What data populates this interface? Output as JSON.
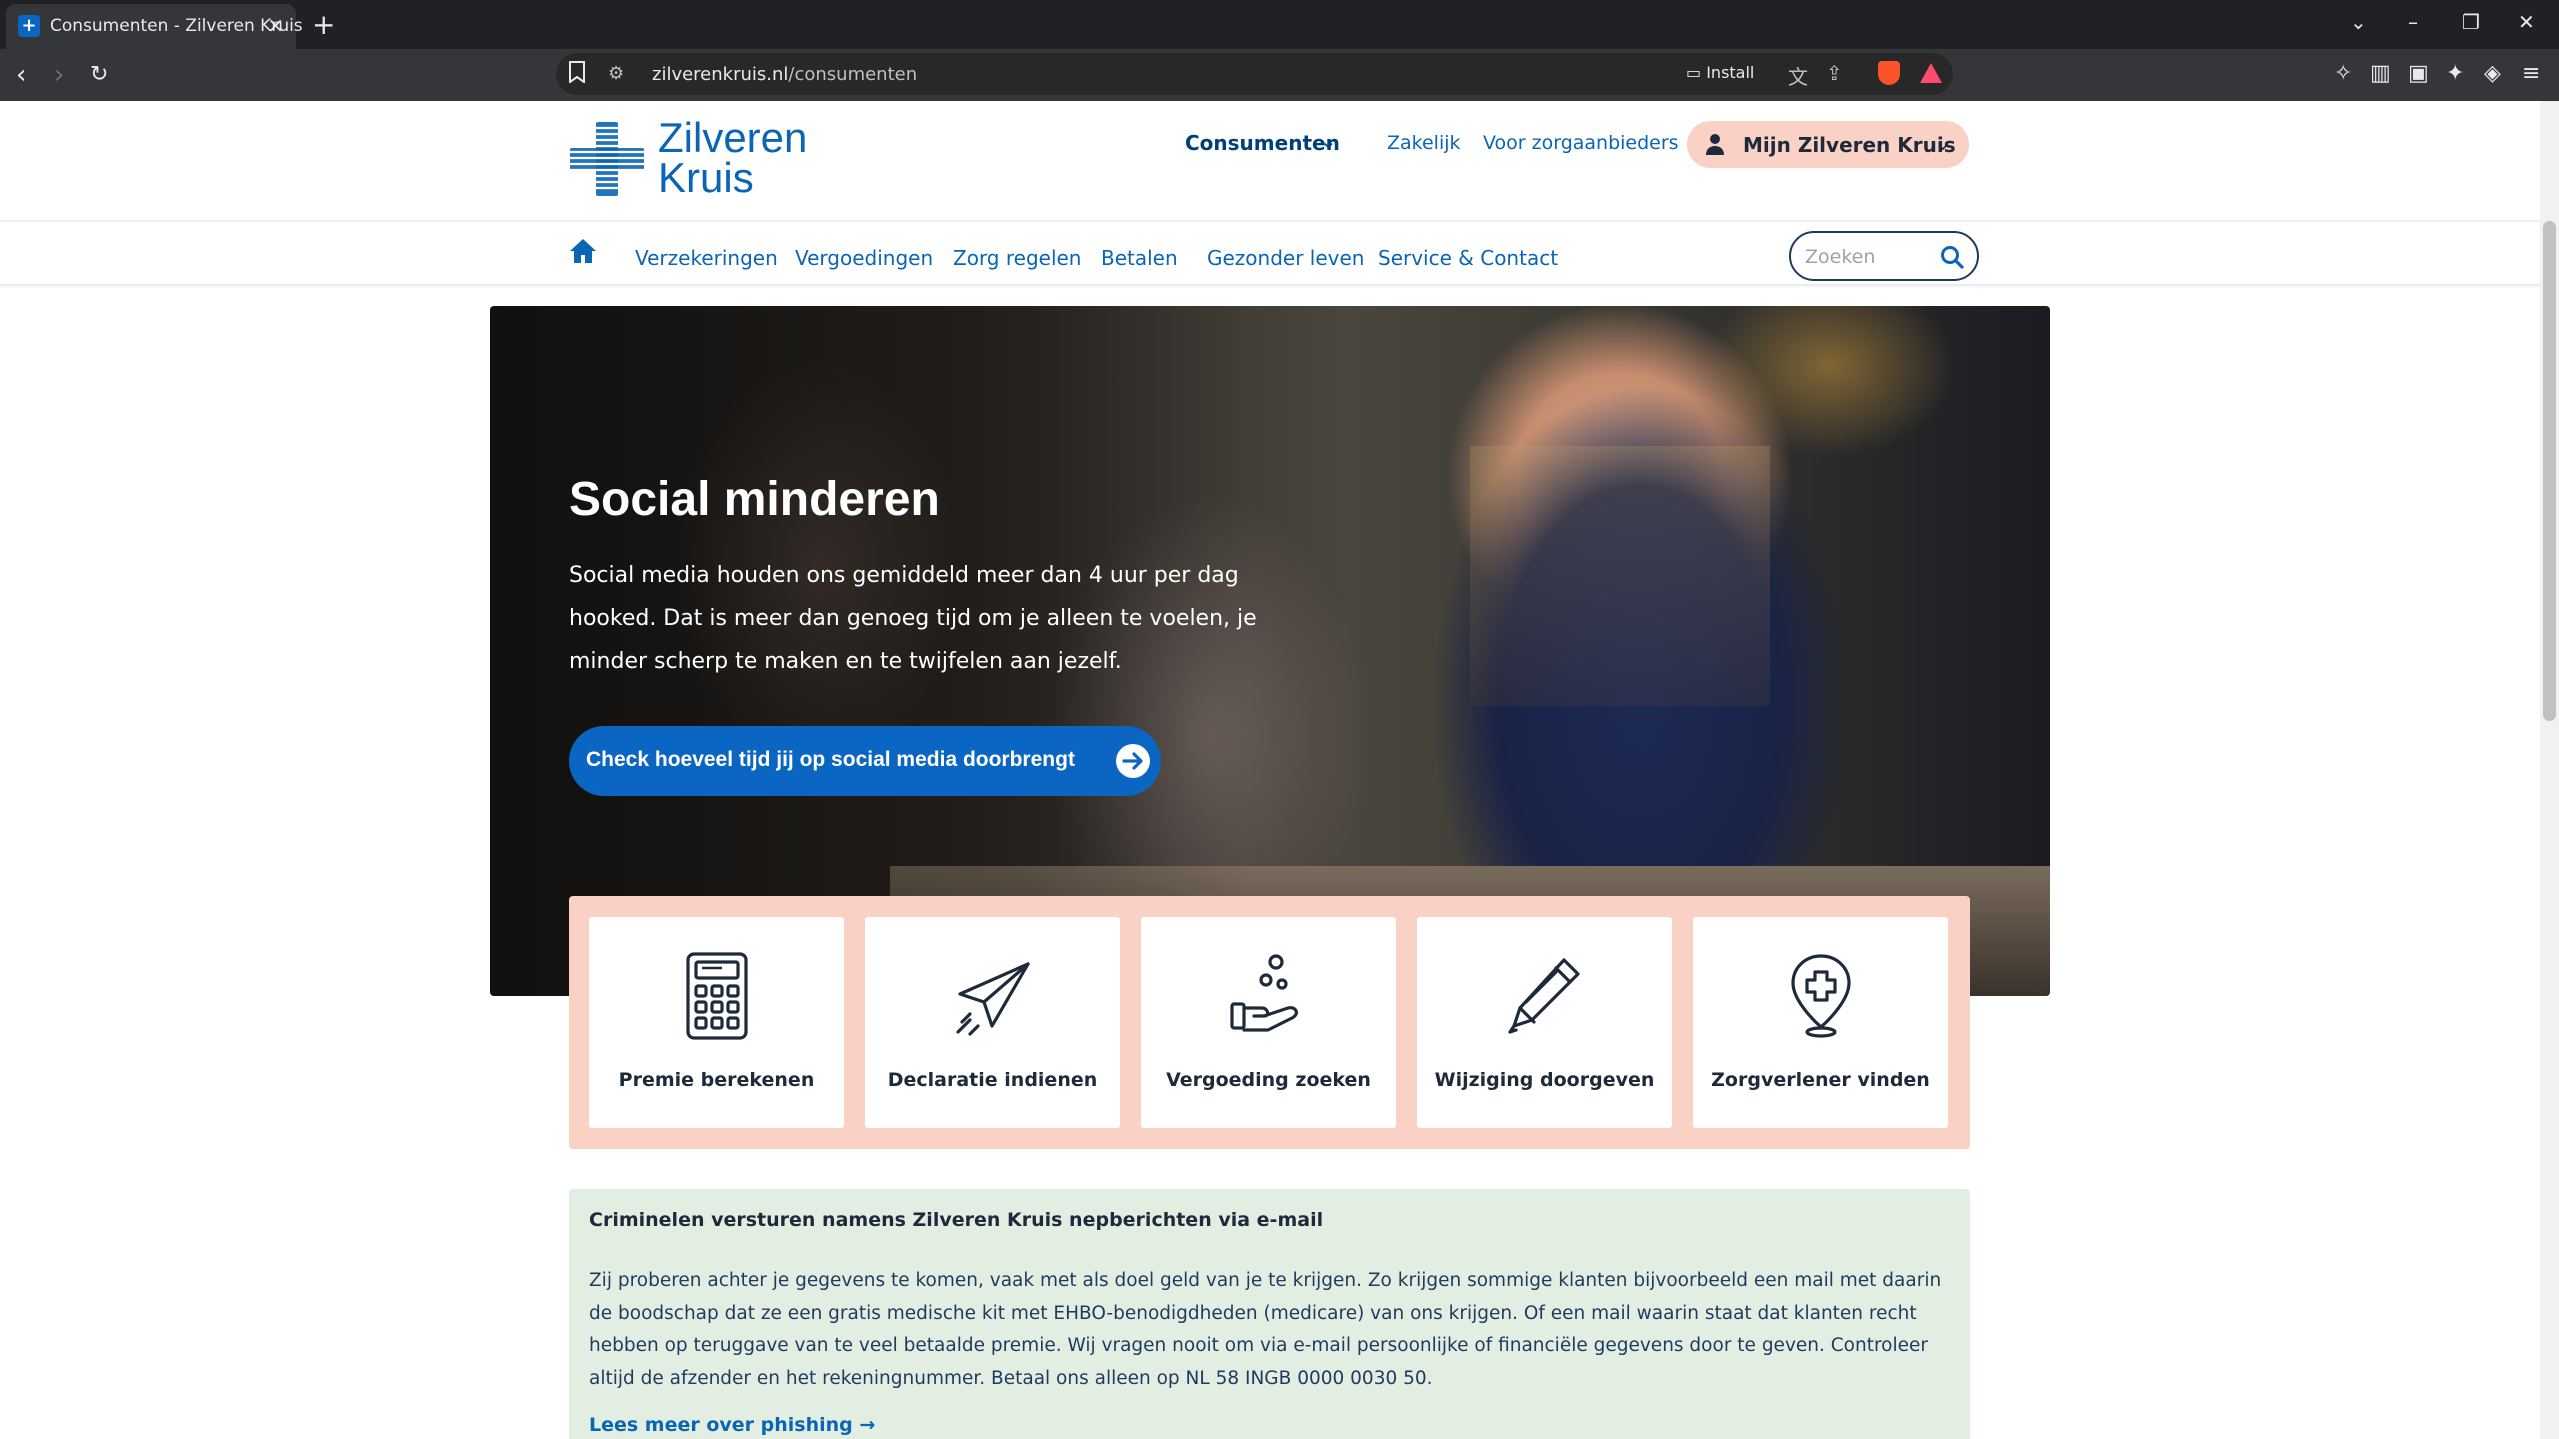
{
  "browser": {
    "tab_title": "Consumenten - Zilveren Kruis",
    "url_domain": "zilverenkruis.nl",
    "url_path": "/consumenten",
    "install_label": "Install"
  },
  "header": {
    "logo_line1": "Zilveren",
    "logo_line2": "Kruis",
    "consumer_menu": "Consumenten",
    "business_link": "Zakelijk",
    "providers_link": "Voor zorgaanbieders",
    "account_button": "Mijn Zilveren Kruis"
  },
  "subnav": {
    "items": [
      {
        "label": "Verzekeringen"
      },
      {
        "label": "Vergoedingen"
      },
      {
        "label": "Zorg regelen"
      },
      {
        "label": "Betalen"
      },
      {
        "label": "Gezonder leven"
      },
      {
        "label": "Service & Contact"
      }
    ],
    "search_placeholder": "Zoeken"
  },
  "hero": {
    "title": "Social minderen",
    "text": "Social media houden ons gemiddeld meer dan 4 uur per dag hooked. Dat is meer dan genoeg tijd om je alleen te voelen, je minder scherp te maken en te twijfelen aan jezelf.",
    "cta": "Check hoeveel tijd jij op social media doorbrengt"
  },
  "quick_links": [
    {
      "label": "Premie berekenen",
      "icon": "calculator-icon"
    },
    {
      "label": "Declaratie indienen",
      "icon": "paper-plane-icon"
    },
    {
      "label": "Vergoeding zoeken",
      "icon": "hand-coins-icon"
    },
    {
      "label": "Wijziging doorgeven",
      "icon": "pencil-icon"
    },
    {
      "label": "Zorgverlener vinden",
      "icon": "location-cross-icon"
    }
  ],
  "notice": {
    "title": "Criminelen versturen namens Zilveren Kruis nepberichten via e-mail",
    "body": "Zij proberen achter je gegevens te komen, vaak met als doel geld van je te krijgen. Zo krijgen sommige klanten bijvoorbeeld een mail met daarin de boodschap dat ze een gratis medische kit met EHBO-benodigdheden (medicare) van ons krijgen. Of een mail waarin staat dat klanten recht hebben op teruggave van te veel betaalde premie. Wij vragen nooit om via e-mail persoonlijke of financiële gegevens door te geven. Controleer altijd de afzender en het rekeningnummer. Betaal ons alleen op NL 58 INGB 0000 0030 50.",
    "link": "Lees meer over phishing"
  },
  "colors": {
    "brand_blue": "#0a65b5",
    "cta_blue": "#0a66c2",
    "peach": "#f9d2c5",
    "notice_green": "#e3eee3"
  }
}
